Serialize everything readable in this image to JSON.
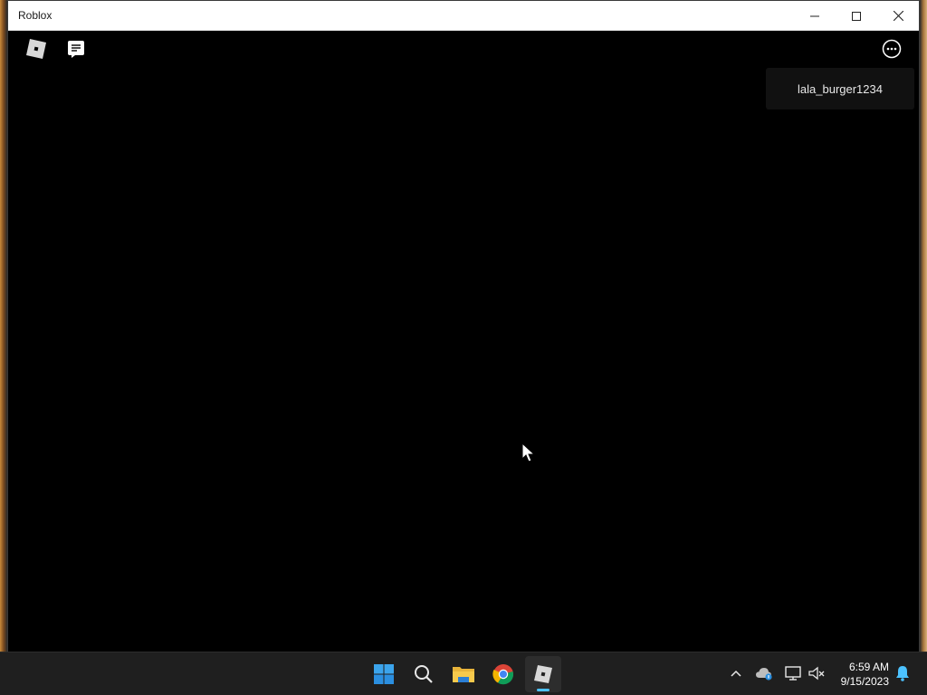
{
  "window": {
    "title": "Roblox",
    "controls": [
      "minimize",
      "maximize",
      "close"
    ]
  },
  "toolbar": {
    "left_icons": [
      "roblox-logo-icon",
      "chat-icon"
    ],
    "right_icons": [
      "more-options-icon"
    ]
  },
  "user_card": {
    "username": "lala_burger1234"
  },
  "taskbar": {
    "apps": [
      "start",
      "search",
      "file-explorer",
      "chrome",
      "roblox"
    ],
    "active_app": "roblox",
    "clock": {
      "time": "6:59 AM",
      "date": "9/15/2023"
    }
  },
  "colors": {
    "background": "#000000",
    "titlebar": "#ffffff",
    "taskbar": "#1f1f1f",
    "accent": "#4cc2ff"
  }
}
